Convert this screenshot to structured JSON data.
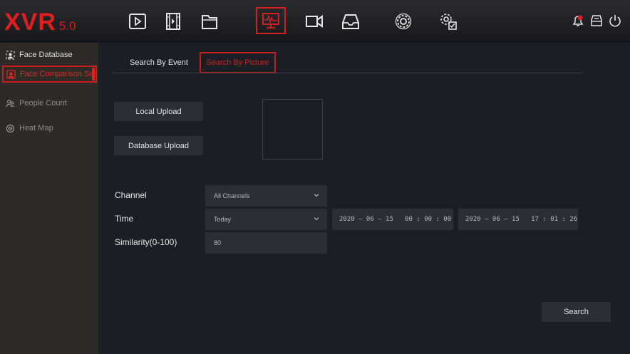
{
  "logo": {
    "brand": "XVR",
    "version": "5.0"
  },
  "nav": {
    "icons": [
      "playback-icon",
      "video-clip-icon",
      "folder-icon",
      "ai-monitor-icon",
      "camera-icon",
      "storage-icon",
      "gear-icon",
      "system-gear-icon"
    ],
    "active": "ai-monitor-icon"
  },
  "topright": {
    "icons": [
      "alarm-bell-icon",
      "backup-icon",
      "power-icon"
    ]
  },
  "sidebar": {
    "items": [
      {
        "label": "Face Database",
        "state": "normal"
      },
      {
        "label": "Face Comparison Search",
        "state": "active"
      },
      {
        "label": "People Count",
        "state": "dim"
      },
      {
        "label": "Heat Map",
        "state": "dim"
      }
    ]
  },
  "tabs": {
    "event": "Search By Event",
    "picture": "Search By Picture"
  },
  "buttons": {
    "local_upload": "Local Upload",
    "database_upload": "Database Upload",
    "search": "Search"
  },
  "form": {
    "channel_label": "Channel",
    "channel_value": "All Channels",
    "time_label": "Time",
    "time_value": "Today",
    "start_time": "2020 – 06 – 15   00 : 00 : 00",
    "end_time": "2020 – 06 – 15   17 : 01 : 26",
    "similarity_label": "Similarity(0-100)",
    "similarity_value": "80"
  },
  "colors": {
    "accent": "#d12020",
    "panel": "#1b1f25",
    "sidebar": "#2e2b27",
    "button": "#2b3038"
  }
}
